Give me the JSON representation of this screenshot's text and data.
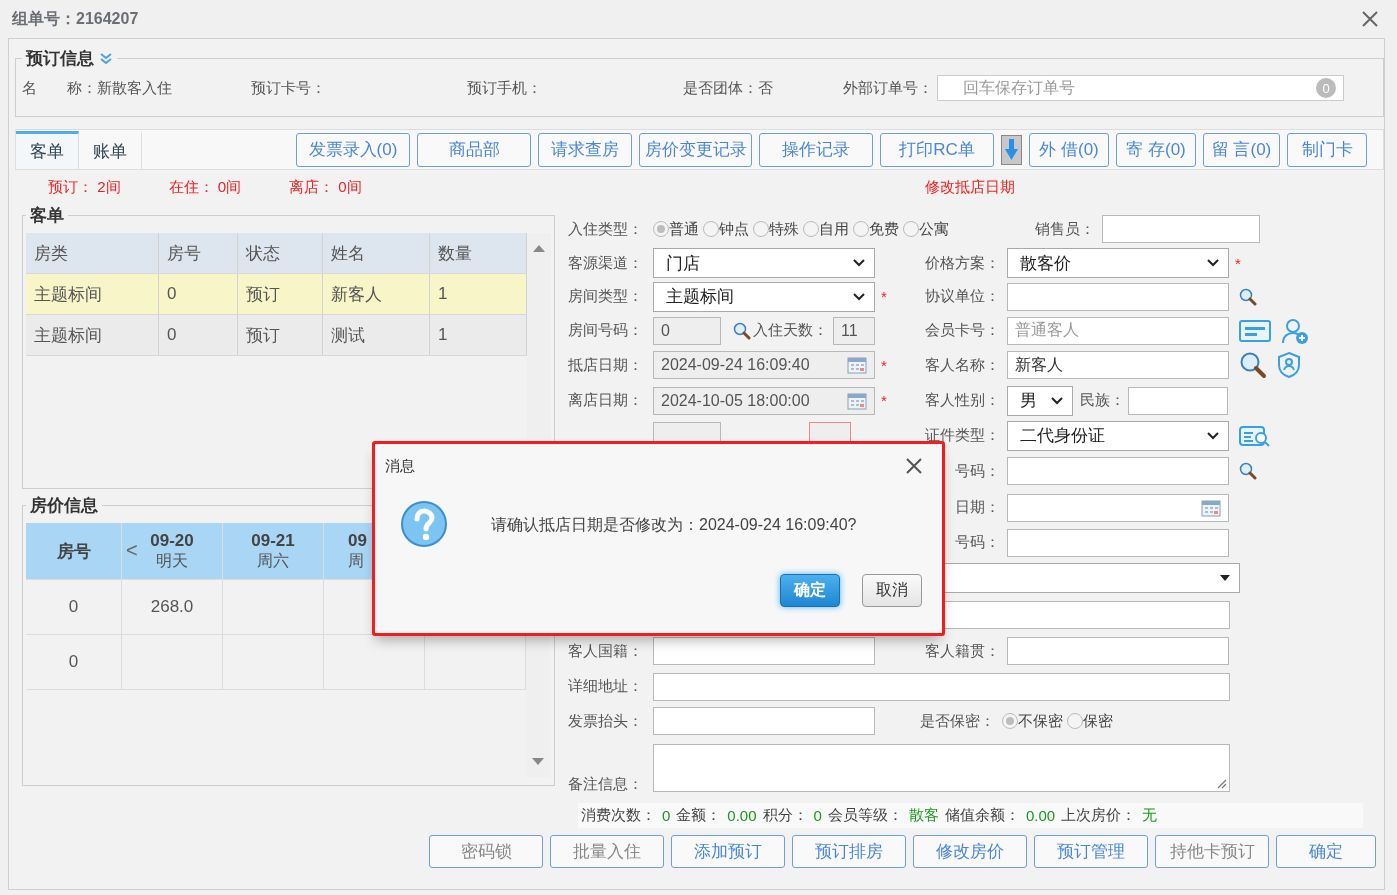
{
  "window": {
    "title": "组单号：2164207"
  },
  "booking_info": {
    "legend": "预订信息",
    "fields": [
      {
        "label": "名　　称：",
        "value": "新散客入住"
      },
      {
        "label": "预订卡号："
      },
      {
        "label": "预订手机："
      },
      {
        "label": "是否团体：",
        "value": "否"
      },
      {
        "label": "外部订单号：",
        "placeholder": "回车保存订单号",
        "badge": "0"
      }
    ]
  },
  "tabs": [
    {
      "label": "客单",
      "selected": true
    },
    {
      "label": "账单",
      "selected": false
    }
  ],
  "toolbar": [
    {
      "kind": "button",
      "label": "发票录入(0)"
    },
    {
      "kind": "button",
      "label": "商品部"
    },
    {
      "kind": "button",
      "label": "请求查房"
    },
    {
      "kind": "button",
      "label": "房价变更记录"
    },
    {
      "kind": "button",
      "label": "操作记录"
    },
    {
      "kind": "button",
      "label": "打印RC单"
    },
    {
      "kind": "download"
    },
    {
      "kind": "button",
      "label": "外 借(0)"
    },
    {
      "kind": "button",
      "label": "寄 存(0)"
    },
    {
      "kind": "button",
      "label": "留 言(0)"
    },
    {
      "kind": "button",
      "label": "制门卡"
    }
  ],
  "counts": [
    "预订： 2间",
    "在住： 0间",
    "离店： 0间"
  ],
  "notice": "修改抵店日期",
  "guest_list": {
    "legend": "客单",
    "columns": [
      "房类",
      "房号",
      "状态",
      "姓名",
      "数量"
    ],
    "rows": [
      {
        "cells": [
          "主题标间",
          "0",
          "预订",
          "新客人",
          "1"
        ],
        "selected": true
      },
      {
        "cells": [
          "主题标间",
          "0",
          "预订",
          "测试",
          "1"
        ],
        "selected": false
      }
    ]
  },
  "rate_info": {
    "legend": "房价信息",
    "columns": [
      {
        "title": "房号"
      },
      {
        "prev": "<",
        "date": "09-20",
        "day": "明天"
      },
      {
        "date": "09-21",
        "day": "周六"
      },
      {
        "date": "09",
        "day": "周"
      }
    ],
    "rows": [
      {
        "room": "0",
        "prices": [
          "268.0"
        ]
      },
      {
        "room": "0"
      }
    ]
  },
  "form_rows": [
    {
      "left": {
        "kind": "radio",
        "label": "入住类型：",
        "options": [
          {
            "label": "普通",
            "selected": true
          },
          {
            "label": "钟点",
            "selected": false
          },
          {
            "label": "特殊",
            "selected": false
          },
          {
            "label": "自用",
            "selected": false
          },
          {
            "label": "免费",
            "selected": false
          },
          {
            "label": "公寓",
            "selected": false
          }
        ]
      },
      "right": {
        "kind": "input",
        "label": "销售员："
      }
    },
    {
      "left": {
        "kind": "select",
        "label": "客源渠道：",
        "value": "门店"
      },
      "right": {
        "kind": "select",
        "label": "价格方案：",
        "value": "散客价",
        "required_mark": "*"
      }
    },
    {
      "left": {
        "kind": "select",
        "label": "房间类型：",
        "value": "主题标间",
        "required_mark": "*"
      },
      "right": {
        "kind": "input",
        "label": "协议单位："
      }
    },
    {
      "left": {
        "kind": "pair",
        "label": "房间号码：",
        "value": "0",
        "label2": "入住天数：",
        "value2": "11",
        "warning": false
      },
      "right": {
        "kind": "input",
        "label": "会员卡号：",
        "placeholder": "普通客人"
      }
    },
    {
      "left": {
        "kind": "date",
        "label": "抵店日期：",
        "value": "2024-09-24 16:09:40",
        "readonly": true,
        "required_mark": "*"
      },
      "right": {
        "kind": "input",
        "label": "客人名称：",
        "value": "新客人"
      }
    },
    {
      "left": {
        "kind": "date",
        "label": "离店日期：",
        "value": "2024-10-05 18:00:00",
        "readonly": true,
        "required_mark": "*"
      },
      "right": {
        "kind": "select-pair",
        "label": "客人性别：",
        "value": "男",
        "label2": "民族："
      }
    },
    {
      "left": {
        "kind": "pair",
        "warning": true
      },
      "right": {
        "kind": "select",
        "label": "证件类型：",
        "value": "二代身份证"
      }
    },
    {
      "right": {
        "kind": "input",
        "label": "号码："
      }
    },
    {
      "right": {
        "kind": "date",
        "label": "日期：",
        "readonly": false
      }
    },
    {
      "right": {
        "kind": "input",
        "label": "号码："
      }
    },
    {
      "right": {
        "kind": "select"
      }
    },
    {
      "right": {
        "kind": "input"
      }
    },
    {
      "left": {
        "kind": "input",
        "label": "客人国籍："
      },
      "right": {
        "kind": "input",
        "label": "客人籍贯："
      }
    },
    {
      "left": {
        "kind": "input",
        "label": "详细地址："
      }
    },
    {
      "left": {
        "kind": "input",
        "label": "发票抬头："
      },
      "right": {
        "kind": "radio",
        "label": "是否保密：",
        "options": [
          {
            "label": "不保密",
            "selected": true
          },
          {
            "label": "保密",
            "selected": false
          }
        ]
      }
    },
    {
      "left": {
        "kind": "textarea",
        "label": "备注信息："
      }
    }
  ],
  "stats": [
    {
      "label": "消费次数：",
      "value": "0"
    },
    {
      "label": "金额：",
      "value": "0.00"
    },
    {
      "label": "积分：",
      "value": "0"
    },
    {
      "label": "会员等级：",
      "value": "散客"
    },
    {
      "label": "储值余额：",
      "value": "0.00"
    },
    {
      "label": "上次房价：",
      "value": "无"
    }
  ],
  "bottom_buttons": [
    {
      "label": "密码锁",
      "disabled": true
    },
    {
      "label": "批量入住",
      "disabled": true
    },
    {
      "label": "添加预订",
      "disabled": false
    },
    {
      "label": "预订排房",
      "disabled": false
    },
    {
      "label": "修改房价",
      "disabled": false
    },
    {
      "label": "预订管理",
      "disabled": false
    },
    {
      "label": "持他卡预订",
      "disabled": true
    },
    {
      "label": "确定",
      "disabled": false
    }
  ],
  "dialog": {
    "title": "消息",
    "message": "请确认抵店日期是否修改为：2024-09-24 16:09:40?",
    "buttons": [
      {
        "label": "确定",
        "kind": "primary"
      },
      {
        "label": "取消",
        "kind": "default"
      }
    ]
  }
}
